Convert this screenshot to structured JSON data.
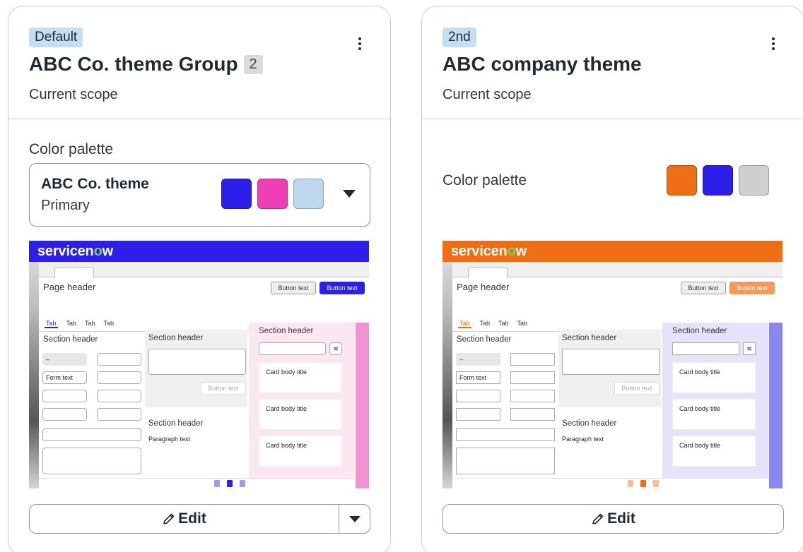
{
  "cards": [
    {
      "badge": "Default",
      "title": "ABC Co. theme Group",
      "count": "2",
      "scope": "Current scope",
      "palette_label": "Color palette",
      "palette_select": {
        "name": "ABC Co. theme",
        "sub": "Primary"
      },
      "swatches": [
        "#2c1fe9",
        "#ee3fb4",
        "#bdd8ee"
      ],
      "preview": {
        "logo_a": "servicen",
        "logo_o": "o",
        "logo_b": "w",
        "header_color": "#2c1fe9",
        "accent": "#2c1fe9",
        "side_color": "#f292d2",
        "right_bg": "#fbe6f1",
        "page_header": "Page header",
        "button_text_1": "Button text",
        "button_text_2": "Button text",
        "tabs": [
          "Tab",
          "Tab",
          "Tab",
          "Tab"
        ],
        "section_header_1": "Section header",
        "section_header_2": "Section header",
        "section_header_3": "Section header",
        "section_header_4": "Section header",
        "field_dash": "–",
        "form_text": "Form text",
        "disabled_button": "Button text",
        "paragraph": "Paragraph text",
        "card_titles": [
          "Card body title",
          "Card body title",
          "Card body title"
        ],
        "filter_icon": "≋"
      },
      "edit_label": "Edit"
    },
    {
      "badge": "2nd",
      "title": "ABC company theme",
      "scope": "Current scope",
      "palette_label": "Color palette",
      "swatches": [
        "#ef6e15",
        "#2c1fe9",
        "#cfcfcf"
      ],
      "preview": {
        "logo_a": "servicen",
        "logo_o": "o",
        "logo_b": "w",
        "header_color": "#ef6e15",
        "accent": "#ef6e15",
        "side_color": "#8b85ef",
        "right_bg": "#e4e3f9",
        "page_header": "Page header",
        "button_text_1": "Button text",
        "button_text_2": "Button text",
        "tabs": [
          "Tab",
          "Tab",
          "Tab",
          "Tab"
        ],
        "section_header_1": "Section header",
        "section_header_2": "Section header",
        "section_header_3": "Section header",
        "section_header_4": "Section header",
        "field_dash": "–",
        "form_text": "Form text",
        "disabled_button": "Button text",
        "paragraph": "Paragraph text",
        "card_titles": [
          "Card body title",
          "Card body title",
          "Card body title"
        ],
        "filter_icon": "≋"
      },
      "edit_label": "Edit"
    }
  ]
}
